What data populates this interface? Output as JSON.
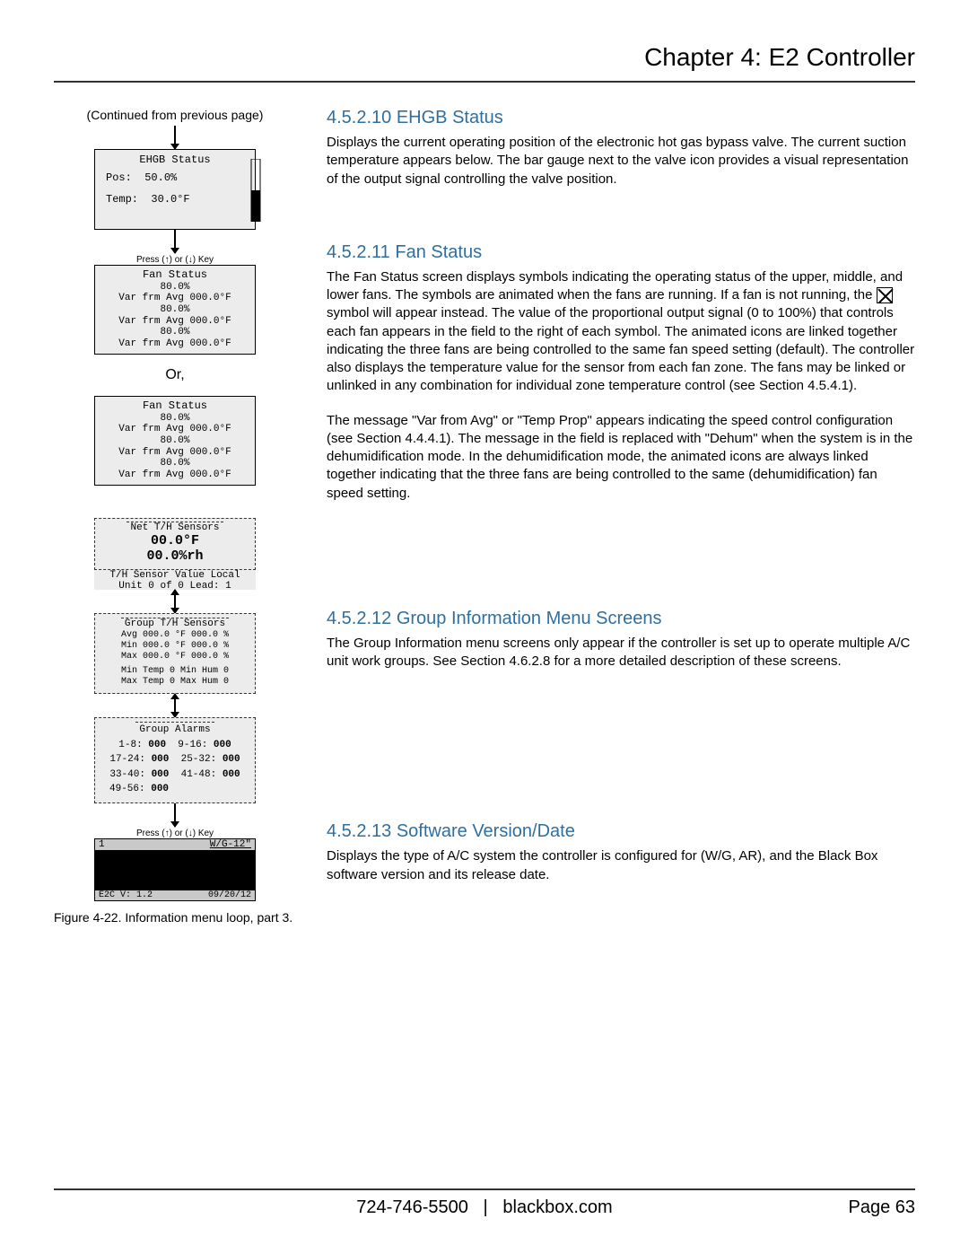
{
  "header": {
    "chapter": "Chapter 4: E2 Controller"
  },
  "left": {
    "continued": "(Continued from previous page)",
    "press_key": "Press (↑) or (↓) Key",
    "or_label": "Or,",
    "ehgb": {
      "title": "EHGB Status",
      "pos_label": "Pos:",
      "pos_val": "50.0%",
      "temp_label": "Temp:",
      "temp_val": "30.0°F"
    },
    "fan1": {
      "title": "Fan Status",
      "l1a": "80.0%",
      "l1b": "Var frm Avg 000.0°F",
      "l2a": "80.0%",
      "l2b": "Var frm Avg 000.0°F",
      "l3a": "80.0%",
      "l3b": "Var frm Avg 000.0°F"
    },
    "fan2": {
      "title": "Fan Status",
      "l1a": "80.0%",
      "l1b": "Var frm Avg 000.0°F",
      "l2a": "80.0%",
      "l2b": "Var frm Avg 000.0°F",
      "l3a": "80.0%",
      "l3b": "Var frm Avg 000.0°F"
    },
    "net": {
      "title": "Net T/H Sensors",
      "temp": "00.0°F",
      "hum": "00.0%rh"
    },
    "local": {
      "line1": "T/H Sensor Value Local",
      "line2": "Unit 0 of 0  Lead: 1"
    },
    "group": {
      "title": "Group T/H Sensors",
      "r1": "Avg 000.0 °F   000.0 %",
      "r2": "Min 000.0 °F   000.0 %",
      "r3": "Max 000.0 °F   000.0 %",
      "r4": "Min Temp 0   Min Hum 0",
      "r5": "Max Temp 0   Max Hum 0"
    },
    "alarms": {
      "title": "Group Alarms",
      "r1a": "1-8:",
      "r1b": "000",
      "r1c": "9-16:",
      "r1d": "000",
      "r2a": "17-24:",
      "r2b": "000",
      "r2c": "25-32:",
      "r2d": "000",
      "r3a": "33-40:",
      "r3b": "000",
      "r3c": "41-48:",
      "r3d": "000",
      "r4a": "49-56:",
      "r4b": "000"
    },
    "ver": {
      "top_left": "1",
      "top_right": "W/G-12\"",
      "bot_left": "E2C V: 1.2",
      "bot_right": "09/20/12"
    },
    "caption": "Figure 4-22. Information menu loop, part 3."
  },
  "sections": {
    "s10": {
      "title": "4.5.2.10 EHGB Status",
      "body": "Displays the current operating position of the electronic hot gas bypass valve. The current suction temperature appears below. The bar gauge next to the valve icon provides a visual representation of the output signal controlling the valve position."
    },
    "s11": {
      "title": "4.5.2.11 Fan Status",
      "body1a": "The Fan Status screen displays symbols indicating the operating status of the upper, middle, and lower fans. The symbols are animated when the fans are running. If a fan is not running, the ",
      "body1b": " symbol will appear instead. The value of the proportional output signal (0 to 100%) that controls each fan appears in the field to the right of each symbol. The animated icons are linked together indicating the three fans are being controlled to the same fan speed setting (default). The controller also displays the temperature value for the sensor from each fan zone. The fans may be linked or unlinked in any combination for individual zone temperature control (see Section 4.5.4.1).",
      "body2": "The message \"Var from Avg\" or \"Temp Prop\" appears indicating the speed control configuration (see Section 4.4.4.1). The message in the field is replaced with \"Dehum\" when the system is in the dehumidification mode. In the dehumidification mode, the animated icons are always linked together indicating that the three fans are being controlled to the same (dehumidification) fan speed setting."
    },
    "s12": {
      "title": "4.5.2.12 Group Information Menu Screens",
      "body": "The Group Information menu screens only appear if the controller is set up to operate multiple A/C unit work groups. See Section 4.6.2.8 for a more detailed description of these screens."
    },
    "s13": {
      "title": "4.5.2.13 Software Version/Date",
      "body": "Displays the type of A/C system the controller is configured for (W/G, AR), and the Black Box software version and its release date."
    }
  },
  "footer": {
    "phone": "724-746-5500",
    "sep": "|",
    "site": "blackbox.com",
    "page": "Page 63"
  }
}
